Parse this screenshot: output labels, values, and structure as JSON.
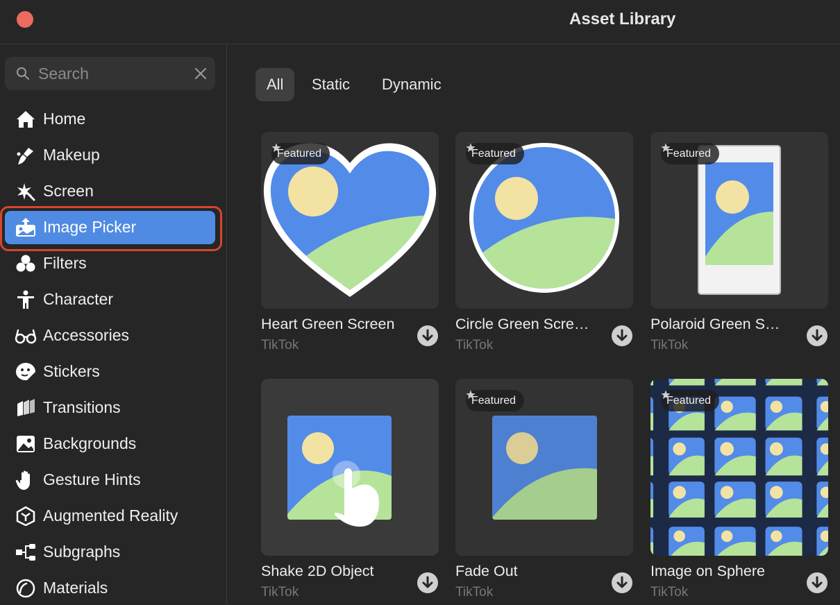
{
  "window": {
    "title": "Asset Library"
  },
  "search": {
    "placeholder": "Search"
  },
  "sidebar": {
    "items": [
      {
        "label": "Home",
        "icon": "home-icon"
      },
      {
        "label": "Makeup",
        "icon": "makeup-brush-icon"
      },
      {
        "label": "Screen",
        "icon": "screen-sparkle-icon"
      },
      {
        "label": "Image Picker",
        "icon": "image-picker-icon",
        "active": true
      },
      {
        "label": "Filters",
        "icon": "filters-icon"
      },
      {
        "label": "Character",
        "icon": "character-icon"
      },
      {
        "label": "Accessories",
        "icon": "glasses-icon"
      },
      {
        "label": "Stickers",
        "icon": "sticker-icon"
      },
      {
        "label": "Transitions",
        "icon": "transitions-icon"
      },
      {
        "label": "Backgrounds",
        "icon": "backgrounds-icon"
      },
      {
        "label": "Gesture Hints",
        "icon": "hand-icon"
      },
      {
        "label": "Augmented Reality",
        "icon": "ar-cube-icon"
      },
      {
        "label": "Subgraphs",
        "icon": "subgraph-icon"
      },
      {
        "label": "Materials",
        "icon": "materials-icon"
      }
    ]
  },
  "tabs": [
    {
      "label": "All",
      "active": true
    },
    {
      "label": "Static"
    },
    {
      "label": "Dynamic"
    }
  ],
  "badge_label": "Featured",
  "cards": [
    {
      "name": "Heart Green Screen",
      "author": "TikTok",
      "featured": true
    },
    {
      "name": "Circle Green Scre…",
      "author": "TikTok",
      "featured": true
    },
    {
      "name": "Polaroid Green S…",
      "author": "TikTok",
      "featured": true
    },
    {
      "name": "Shake 2D Object",
      "author": "TikTok",
      "featured": false
    },
    {
      "name": "Fade Out",
      "author": "TikTok",
      "featured": true
    },
    {
      "name": "Image on Sphere",
      "author": "TikTok",
      "featured": true
    }
  ],
  "colors": {
    "accent": "#4f8be2",
    "close": "#ed6a5e",
    "highlight": "#d6452e",
    "sky": "#538be8",
    "hill": "#b6e39a",
    "sun": "#f2e3a3"
  }
}
